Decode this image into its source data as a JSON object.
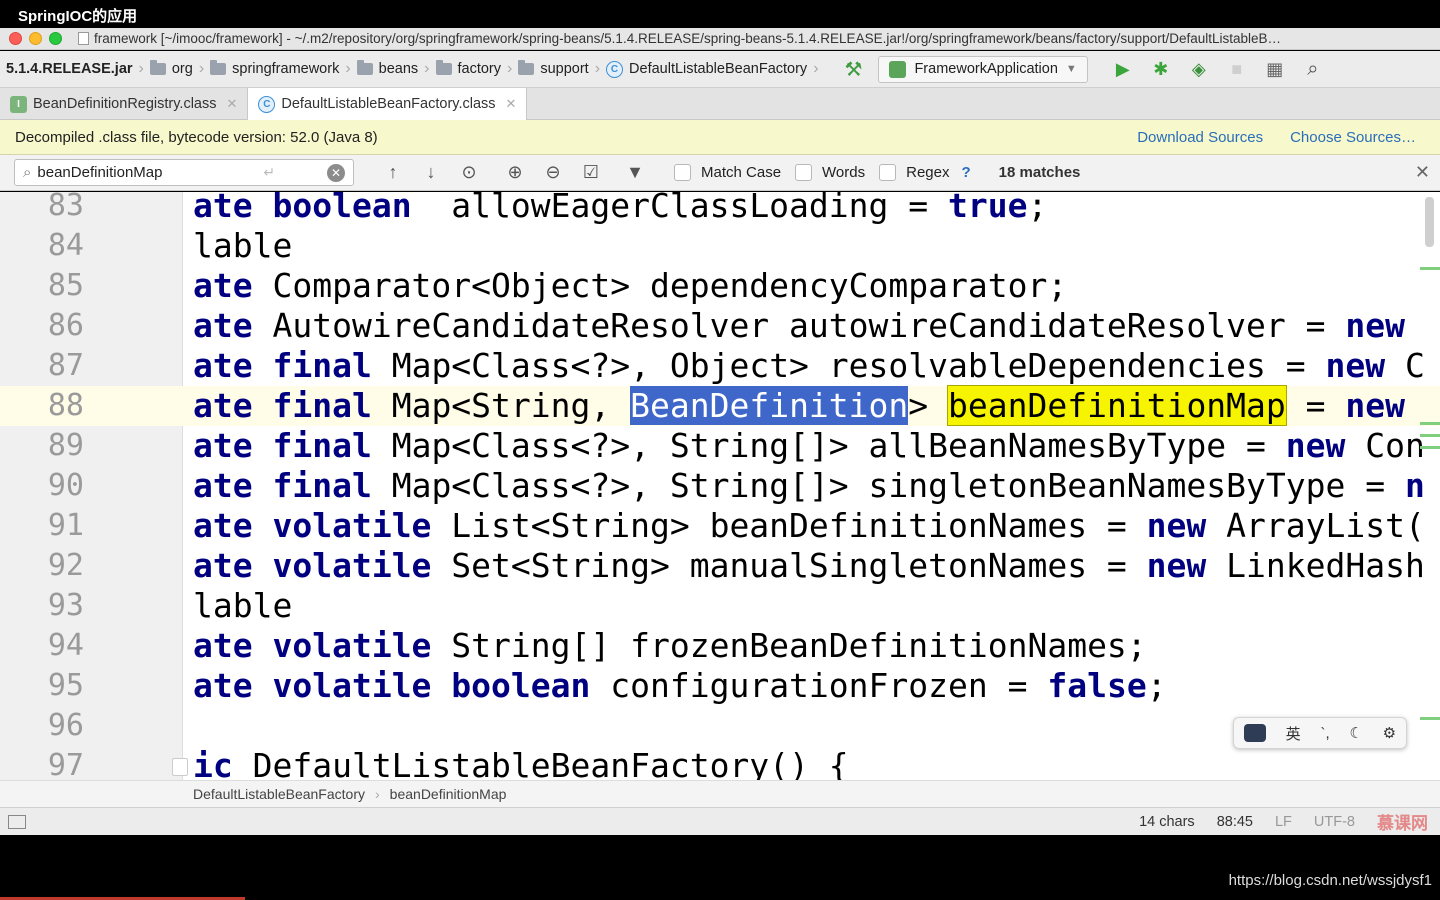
{
  "video_title": "SpringIOC的应用",
  "window": {
    "title": "framework [~/imooc/framework] - ~/.m2/repository/org/springframework/spring-beans/5.1.4.RELEASE/spring-beans-5.1.4.RELEASE.jar!/org/springframework/beans/factory/support/DefaultListableB…"
  },
  "nav": {
    "crumbs": [
      "5.1.4.RELEASE.jar",
      "org",
      "springframework",
      "beans",
      "factory",
      "support",
      "DefaultListableBeanFactory"
    ],
    "run_config": "FrameworkApplication",
    "class_icon": "C"
  },
  "tabs": [
    {
      "label": "BeanDefinitionRegistry.class",
      "icon": "I"
    },
    {
      "label": "DefaultListableBeanFactory.class",
      "icon": "C"
    }
  ],
  "banner": {
    "text": "Decompiled .class file, bytecode version: 52.0 (Java 8)",
    "download": "Download Sources",
    "choose": "Choose Sources…"
  },
  "search": {
    "value": "beanDefinitionMap",
    "match_case": "Match Case",
    "words": "Words",
    "regex": "Regex",
    "help": "?",
    "matches": "18 matches"
  },
  "lines": [
    {
      "num": "83",
      "tokens": [
        [
          "kw",
          "ate "
        ],
        [
          "kw",
          "boolean"
        ],
        [
          "",
          "  allowEagerClassLoading = "
        ],
        [
          "kw",
          "true"
        ],
        [
          "",
          ";"
        ]
      ]
    },
    {
      "num": "84",
      "tokens": [
        [
          "",
          "lable"
        ]
      ]
    },
    {
      "num": "85",
      "tokens": [
        [
          "kw",
          "ate "
        ],
        [
          "",
          "Comparator<Object> dependencyComparator;"
        ]
      ]
    },
    {
      "num": "86",
      "tokens": [
        [
          "kw",
          "ate "
        ],
        [
          "",
          "AutowireCandidateResolver autowireCandidateResolver = "
        ],
        [
          "kw",
          "new "
        ]
      ]
    },
    {
      "num": "87",
      "tokens": [
        [
          "kw",
          "ate "
        ],
        [
          "kw",
          "final "
        ],
        [
          "",
          "Map<Class<?>, Object> resolvableDependencies = "
        ],
        [
          "kw",
          "new "
        ],
        [
          "",
          "C"
        ]
      ]
    },
    {
      "num": "88",
      "tokens": [
        [
          "kw",
          "ate "
        ],
        [
          "kw",
          "final "
        ],
        [
          "",
          "Map<String, "
        ],
        [
          "sel",
          "BeanDefinition"
        ],
        [
          "",
          "> "
        ],
        [
          "hit",
          "beanDefinitionMap"
        ],
        [
          "",
          " = "
        ],
        [
          "kw",
          "new "
        ]
      ]
    },
    {
      "num": "89",
      "tokens": [
        [
          "kw",
          "ate "
        ],
        [
          "kw",
          "final "
        ],
        [
          "",
          "Map<Class<?>, String[]> allBeanNamesByType = "
        ],
        [
          "kw",
          "new "
        ],
        [
          "",
          "Con"
        ]
      ]
    },
    {
      "num": "90",
      "tokens": [
        [
          "kw",
          "ate "
        ],
        [
          "kw",
          "final "
        ],
        [
          "",
          "Map<Class<?>, String[]> singletonBeanNamesByType = "
        ],
        [
          "kw",
          "n"
        ]
      ]
    },
    {
      "num": "91",
      "tokens": [
        [
          "kw",
          "ate "
        ],
        [
          "kw",
          "volatile "
        ],
        [
          "",
          "List<String> beanDefinitionNames = "
        ],
        [
          "kw",
          "new "
        ],
        [
          "",
          "ArrayList("
        ]
      ]
    },
    {
      "num": "92",
      "tokens": [
        [
          "kw",
          "ate "
        ],
        [
          "kw",
          "volatile "
        ],
        [
          "",
          "Set<String> manualSingletonNames = "
        ],
        [
          "kw",
          "new "
        ],
        [
          "",
          "LinkedHash"
        ]
      ]
    },
    {
      "num": "93",
      "tokens": [
        [
          "",
          "lable"
        ]
      ]
    },
    {
      "num": "94",
      "tokens": [
        [
          "kw",
          "ate "
        ],
        [
          "kw",
          "volatile "
        ],
        [
          "",
          "String[] frozenBeanDefinitionNames;"
        ]
      ]
    },
    {
      "num": "95",
      "tokens": [
        [
          "kw",
          "ate "
        ],
        [
          "kw",
          "volatile "
        ],
        [
          "kw",
          "boolean "
        ],
        [
          "",
          "configurationFrozen = "
        ],
        [
          "kw",
          "false"
        ],
        [
          "",
          ";"
        ]
      ]
    },
    {
      "num": "96",
      "tokens": []
    },
    {
      "num": "97",
      "tokens": [
        [
          "kw",
          "ic "
        ],
        [
          "",
          "DefaultListableBeanFactory() {"
        ]
      ]
    }
  ],
  "current_line": "88",
  "ime": {
    "lang": "英",
    "symbols": "`,",
    "gear": "⚙"
  },
  "footer_crumbs": [
    "DefaultListableBeanFactory",
    "beanDefinitionMap"
  ],
  "status": {
    "chars": "14 chars",
    "position": "88:45",
    "line_sep": "LF",
    "encoding": "UTF-8",
    "brand": "慕课网"
  },
  "url": "https://blog.csdn.net/wssjdysf1"
}
